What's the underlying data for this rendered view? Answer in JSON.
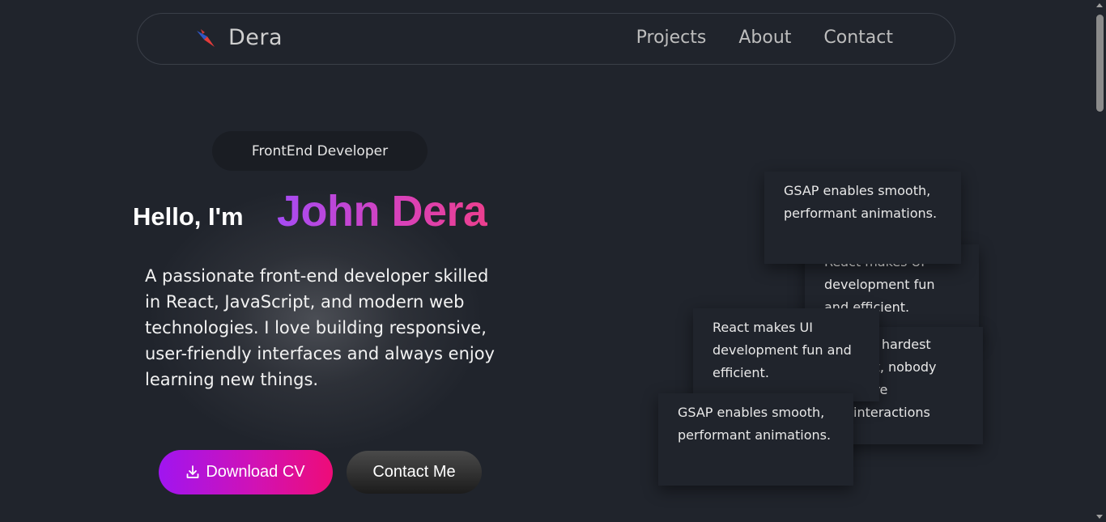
{
  "nav": {
    "brand": "Dera",
    "links": [
      "Projects",
      "About",
      "Contact"
    ]
  },
  "hero": {
    "role": "FrontEnd Developer",
    "greeting": "Hello, I'm",
    "name": "John Dera",
    "bio": "A passionate front-end developer skilled in React, JavaScript, and modern web technologies. I love building responsive, user-friendly interfaces and always enjoy learning new things.",
    "download_label": "Download CV",
    "contact_label": "Contact Me"
  },
  "cards": [
    "React makes UI development fun and efficient.",
    "The hardest part, nobody there interactions",
    "GSAP enables smooth, performant animations.",
    "React makes UI development fun and efficient.",
    "GSAP enables smooth, performant animations."
  ],
  "colors": {
    "background": "#20242c",
    "name_gradient_start": "#a64bf4",
    "name_gradient_end": "#ec3f8e",
    "download_gradient_start": "#a015f0",
    "download_gradient_end": "#ee0c78"
  }
}
